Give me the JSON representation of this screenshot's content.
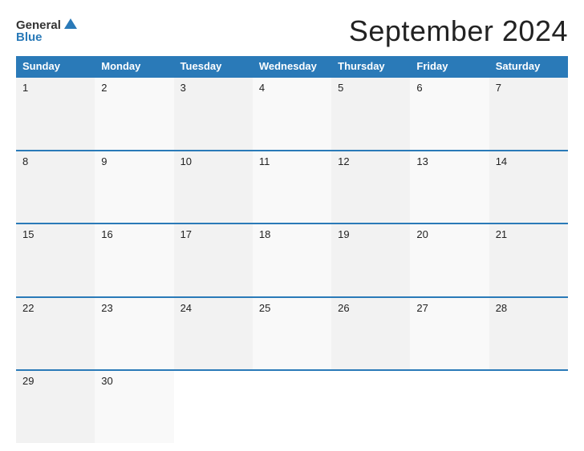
{
  "logo": {
    "general": "General",
    "blue": "Blue"
  },
  "title": "September 2024",
  "day_headers": [
    "Sunday",
    "Monday",
    "Tuesday",
    "Wednesday",
    "Thursday",
    "Friday",
    "Saturday"
  ],
  "weeks": [
    [
      "1",
      "2",
      "3",
      "4",
      "5",
      "6",
      "7"
    ],
    [
      "8",
      "9",
      "10",
      "11",
      "12",
      "13",
      "14"
    ],
    [
      "15",
      "16",
      "17",
      "18",
      "19",
      "20",
      "21"
    ],
    [
      "22",
      "23",
      "24",
      "25",
      "26",
      "27",
      "28"
    ],
    [
      "29",
      "30",
      "",
      "",
      "",
      "",
      ""
    ]
  ]
}
